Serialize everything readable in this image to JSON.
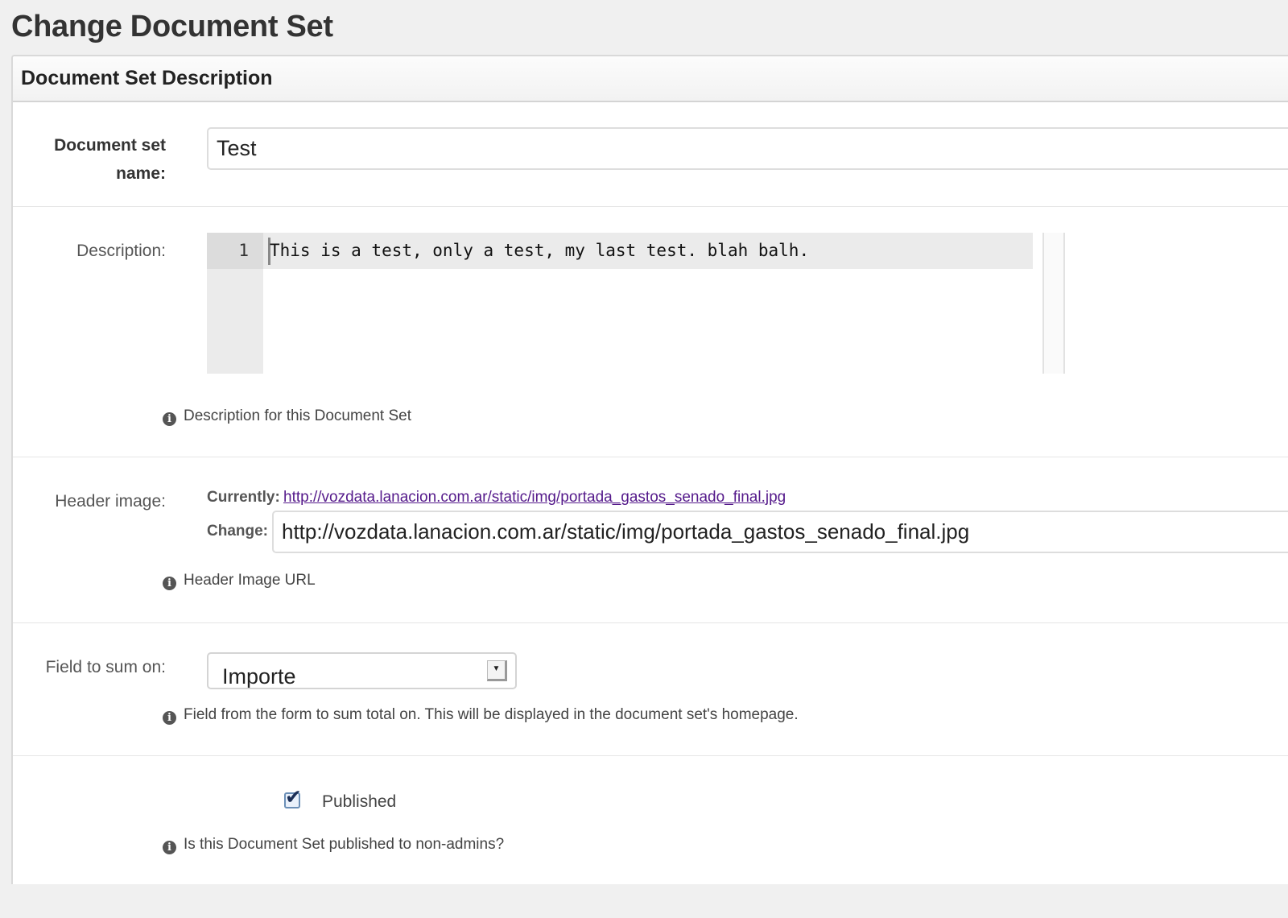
{
  "page": {
    "title": "Change Document Set"
  },
  "fieldset": {
    "title": "Document Set Description"
  },
  "name_field": {
    "label_line1": "Document set",
    "label_line2": "name:",
    "value": "Test"
  },
  "description_field": {
    "label": "Description:",
    "line_number": "1",
    "code_text": "This is a test, only a test, my last test. blah balh.",
    "help": "Description for this Document Set"
  },
  "header_image_field": {
    "label": "Header image:",
    "currently_label": "Currently:",
    "current_url": "http://vozdata.lanacion.com.ar/static/img/portada_gastos_senado_final.jpg",
    "change_label": "Change:",
    "change_value": "http://vozdata.lanacion.com.ar/static/img/portada_gastos_senado_final.jpg",
    "help": "Header Image URL"
  },
  "sum_field": {
    "label": "Field to sum on:",
    "selected": "Importe",
    "help": "Field from the form to sum total on. This will be displayed in the document set's homepage."
  },
  "published_field": {
    "label": "Published",
    "checked": true,
    "help": "Is this Document Set published to non-admins?"
  }
}
